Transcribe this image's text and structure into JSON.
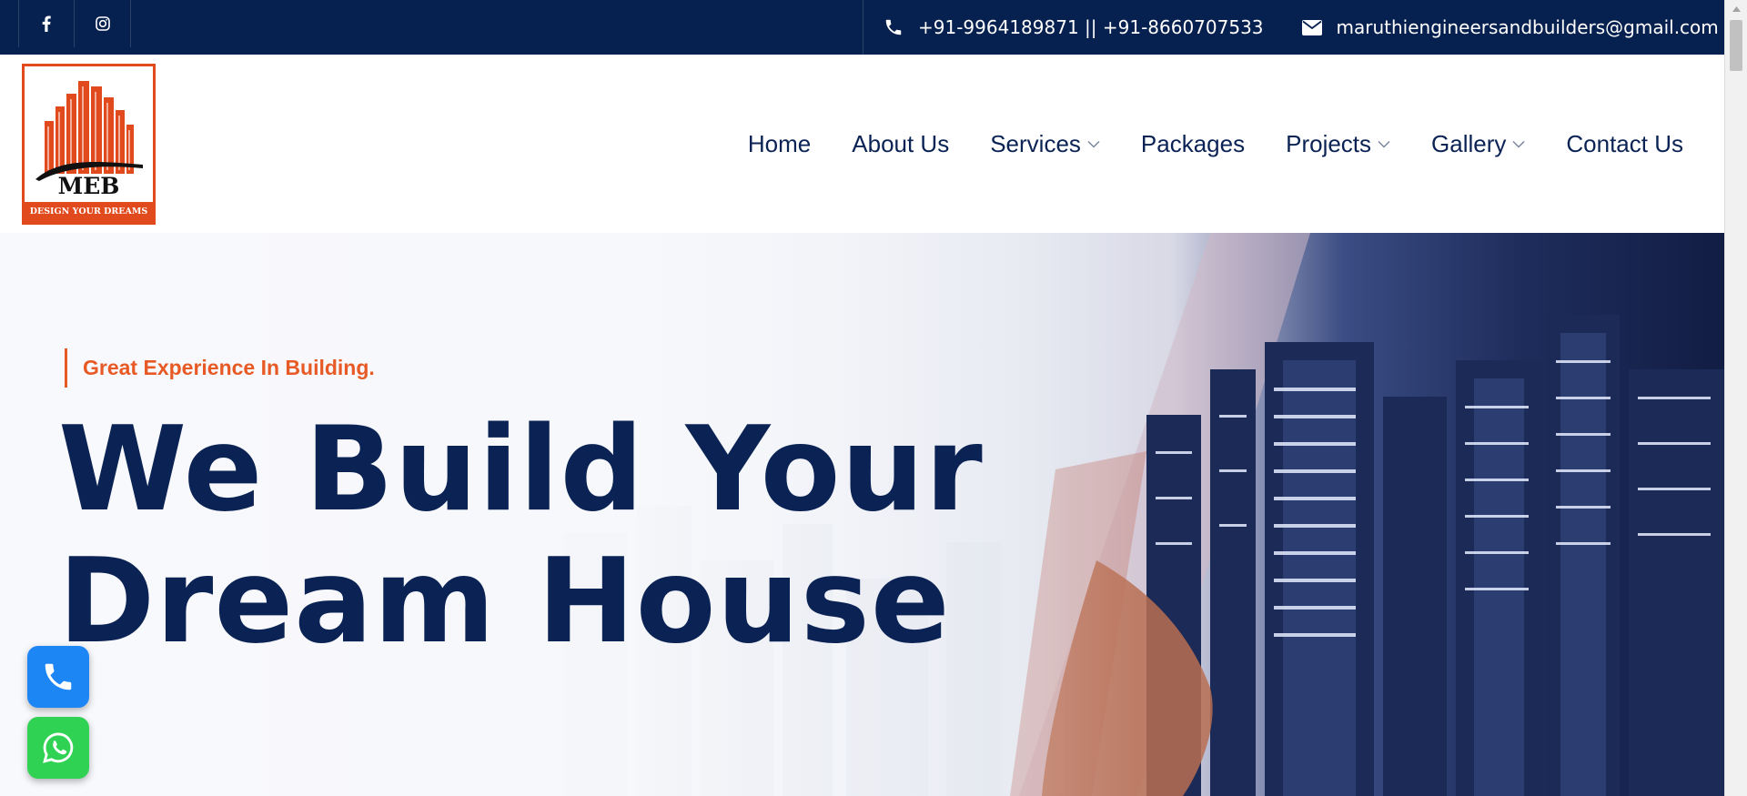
{
  "topbar": {
    "social": [
      {
        "name": "facebook-icon",
        "glyph": "f"
      },
      {
        "name": "instagram-icon",
        "glyph": ""
      }
    ],
    "phone_text": "+91-9964189871 || +91-8660707533",
    "email_text": "maruthiengineersandbuilders@gmail.com"
  },
  "logo": {
    "title": "MEB",
    "tagline": "DESIGN YOUR DREAMS"
  },
  "nav": {
    "items": [
      {
        "label": "Home",
        "has_dropdown": false
      },
      {
        "label": "About Us",
        "has_dropdown": false
      },
      {
        "label": "Services",
        "has_dropdown": true
      },
      {
        "label": "Packages",
        "has_dropdown": false
      },
      {
        "label": "Projects",
        "has_dropdown": true
      },
      {
        "label": "Gallery",
        "has_dropdown": true
      },
      {
        "label": "Contact Us",
        "has_dropdown": false
      }
    ]
  },
  "hero": {
    "kicker": "Great Experience In Building.",
    "headline_line1": "We Build Your",
    "headline_line2": "Dream House"
  },
  "floating": {
    "call_icon": "phone-icon",
    "whatsapp_icon": "whatsapp-icon"
  },
  "colors": {
    "navy": "#06204f",
    "heading": "#0b2354",
    "accent": "#e85a25",
    "logo_orange": "#e04a1c",
    "call_blue": "#1d86f5",
    "whatsapp_green": "#2fd253"
  }
}
